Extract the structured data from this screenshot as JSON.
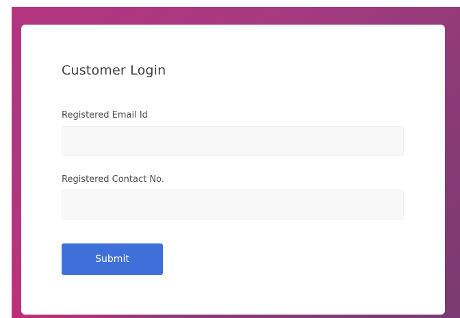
{
  "login": {
    "title": "Customer Login",
    "email_label": "Registered Email Id",
    "email_value": "",
    "email_placeholder": "",
    "contact_label": "Registered Contact No.",
    "contact_value": "",
    "contact_placeholder": "",
    "submit_label": "Submit"
  },
  "colors": {
    "background_gradient_start": "#b4347f",
    "background_gradient_end": "#7a3a72",
    "card": "#ffffff",
    "input_background": "#f8f8f8",
    "submit_button": "#3f70d9",
    "submit_text": "#ffffff",
    "title_text": "#3d3d3d",
    "label_text": "#4a4a4a"
  }
}
